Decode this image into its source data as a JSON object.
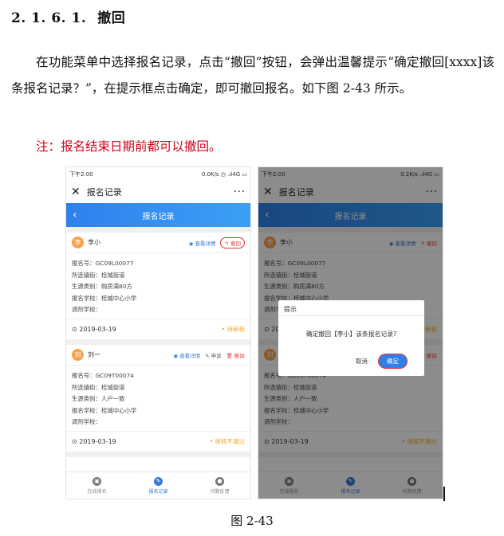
{
  "heading": {
    "number": "2. 1. 6. 1.",
    "title": "撤回"
  },
  "paragraph": "在功能菜单中选择报名记录，点击“撤回”按钮，会弹出温馨提示“确定撤回[xxxx]该条报名记录？”，在提示框点击确定，即可撤回报名。如下图 2-43 所示。",
  "note": "注：报名结束日期前都可以撤回。",
  "caption": "图 2-43",
  "phone": {
    "time": "下午2:00",
    "net": "0.0K/s",
    "net_right": "0.2K/s",
    "signal": "4G",
    "nav_title": "报名记录",
    "page_title": "报名记录",
    "more": "···",
    "view_detail": "查看详情",
    "withdraw": "撤回",
    "appeal": "申诉",
    "delete": "删除",
    "records": [
      {
        "avatar": "李",
        "name": "李小",
        "lines": [
          "报名号：GC09L00077",
          "所选镇街：桂城街道",
          "生源类别：购房满80方",
          "报名学校：桂城中心小学",
          "调剂学校："
        ],
        "date": "2019-03-19",
        "status": "待审核"
      },
      {
        "avatar": "刘",
        "name": "刘一",
        "lines": [
          "报名号：GC09T00074",
          "所选镇街：桂城街道",
          "生源类别：人户一致",
          "报名学校：桂城中心小学",
          "调剂学校："
        ],
        "date": "2019-03-19",
        "status": "审核不通过"
      }
    ],
    "tabs": [
      "在线报名",
      "报名记录",
      "问题反馈"
    ],
    "dialog": {
      "title": "提示",
      "message": "确定撤回【李小】该条报名记录?",
      "cancel": "取消",
      "ok": "确定"
    }
  }
}
